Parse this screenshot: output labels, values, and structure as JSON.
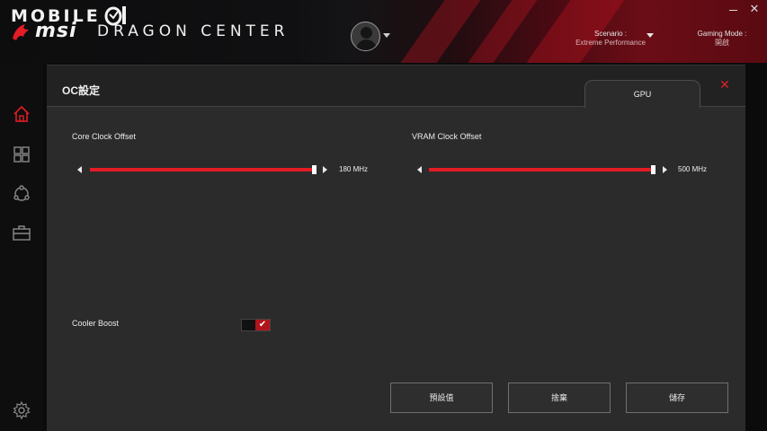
{
  "app": {
    "brand_top": "MOBILE",
    "brand_msi": "msi",
    "brand_name": "DRAGON CENTER"
  },
  "header": {
    "scenario_label": "Scenario :",
    "scenario_value": "Extreme Performance",
    "gaming_label": "Gaming Mode :",
    "gaming_value": "開啟"
  },
  "sidebar": {
    "items": [
      {
        "icon": "home-icon",
        "active": true
      },
      {
        "icon": "grid-icon",
        "active": false
      },
      {
        "icon": "network-icon",
        "active": false
      },
      {
        "icon": "toolbox-icon",
        "active": false
      },
      {
        "icon": "gear-icon",
        "active": false
      }
    ]
  },
  "dialog": {
    "title": "OC設定",
    "tab": "GPU"
  },
  "sliders": {
    "core": {
      "label": "Core Clock Offset",
      "value": "180 MHz",
      "fill_fraction": 1.0
    },
    "vram": {
      "label": "VRAM Clock Offset",
      "value": "500 MHz",
      "fill_fraction": 1.0
    }
  },
  "cooler": {
    "label": "Cooler Boost",
    "checked": true,
    "check_glyph": "✔"
  },
  "buttons": {
    "default": "預設值",
    "discard": "捨棄",
    "save": "儲存"
  },
  "colors": {
    "accent": "#e31c25",
    "panel": "#2b2b2c",
    "background": "#0b0b0c"
  }
}
